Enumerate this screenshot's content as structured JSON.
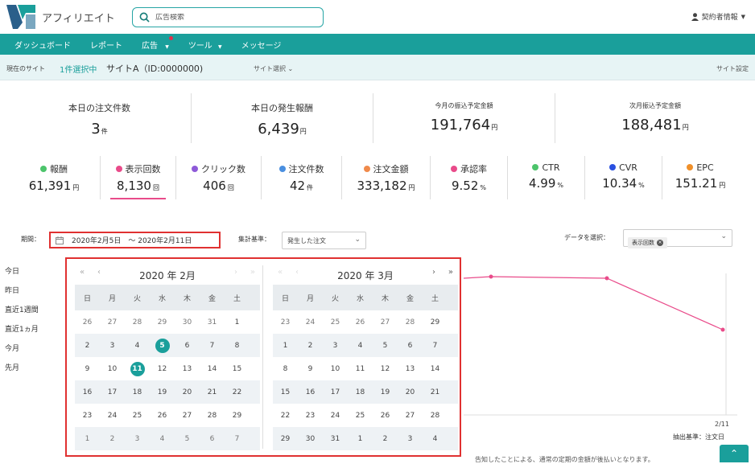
{
  "header": {
    "brand": "アフィリエイト",
    "search_placeholder": "広告検索",
    "user_label": "契約者情報"
  },
  "nav": {
    "items": [
      "ダッシュボード",
      "レポート",
      "広告",
      "ツール",
      "メッセージ"
    ]
  },
  "sitebar": {
    "label": "現在のサイト",
    "count": "1件選択中",
    "site": "サイトA（ID:0000000)",
    "select": "サイト選択",
    "setting": "サイト設定"
  },
  "cards": [
    {
      "label": "本日の注文件数",
      "value": "3",
      "unit": "件"
    },
    {
      "label": "本日の発生報酬",
      "value": "6,439",
      "unit": "円"
    },
    {
      "label": "今月の振込予定金額",
      "value": "191,764",
      "unit": "円"
    },
    {
      "label": "次月振込予定金額",
      "value": "188,481",
      "unit": "円"
    }
  ],
  "metrics": [
    {
      "label": "報酬",
      "value": "61,391",
      "unit": "円",
      "color": "#4cc46b"
    },
    {
      "label": "表示回数",
      "value": "8,130",
      "unit": "回",
      "color": "#e94b8a"
    },
    {
      "label": "クリック数",
      "value": "406",
      "unit": "回",
      "color": "#8e5ad8"
    },
    {
      "label": "注文件数",
      "value": "42",
      "unit": "件",
      "color": "#4a8fe0"
    },
    {
      "label": "注文金額",
      "value": "333,182",
      "unit": "円",
      "color": "#f08a4b"
    },
    {
      "label": "承認率",
      "value": "9.52",
      "unit": "%",
      "color": "#e94b8a"
    },
    {
      "label": "CTR",
      "value": "4.99",
      "unit": "%",
      "color": "#4cc46b"
    },
    {
      "label": "CVR",
      "value": "10.34",
      "unit": "%",
      "color": "#2a50e0"
    },
    {
      "label": "EPC",
      "value": "151.21",
      "unit": "円",
      "color": "#f0902a"
    }
  ],
  "filters": {
    "period_label": "期間：",
    "period_value": "2020年2月5日　〜 2020年2月11日",
    "agg_label": "集計基準：",
    "agg_value": "発生した注文",
    "data_label": "データを選択：",
    "data_chip": "表示回数"
  },
  "quick_ranges": [
    "今日",
    "昨日",
    "直近1週間",
    "直近1ヵ月",
    "今月",
    "先月"
  ],
  "calendar": {
    "dow": [
      "日",
      "月",
      "火",
      "水",
      "木",
      "金",
      "土"
    ],
    "feb": {
      "title": "2020 年 2月",
      "weeks": [
        [
          "26",
          "27",
          "28",
          "29",
          "30",
          "31",
          "1"
        ],
        [
          "2",
          "3",
          "4",
          "5",
          "6",
          "7",
          "8"
        ],
        [
          "9",
          "10",
          "11",
          "12",
          "13",
          "14",
          "15"
        ],
        [
          "16",
          "17",
          "18",
          "19",
          "20",
          "21",
          "22"
        ],
        [
          "23",
          "24",
          "25",
          "26",
          "27",
          "28",
          "29"
        ],
        [
          "1",
          "2",
          "3",
          "4",
          "5",
          "6",
          "7"
        ]
      ]
    },
    "mar": {
      "title": "2020 年 3月",
      "weeks": [
        [
          "23",
          "24",
          "25",
          "26",
          "27",
          "28",
          "29"
        ],
        [
          "1",
          "2",
          "3",
          "4",
          "5",
          "6",
          "7"
        ],
        [
          "8",
          "9",
          "10",
          "11",
          "12",
          "13",
          "14"
        ],
        [
          "15",
          "16",
          "17",
          "18",
          "19",
          "20",
          "21"
        ],
        [
          "22",
          "23",
          "24",
          "25",
          "26",
          "27",
          "28"
        ],
        [
          "29",
          "30",
          "31",
          "1",
          "2",
          "3",
          "4"
        ]
      ]
    }
  },
  "chart_data": {
    "type": "line",
    "x_label_last": "2/11",
    "note": "抽出基準：注文日",
    "series": [
      {
        "values": [
          0.92,
          0.93,
          0.92,
          0.6
        ]
      }
    ],
    "color": "#e94b8a"
  },
  "bottom_text": "告知したことによる、通常の定期の金額が後払いとなります。"
}
